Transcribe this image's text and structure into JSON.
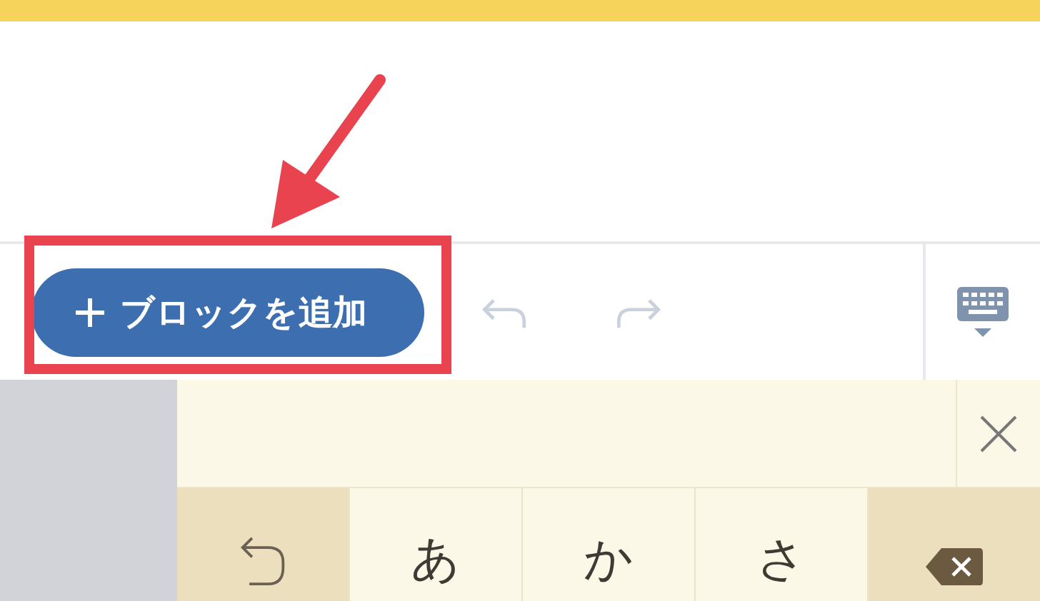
{
  "toolbar": {
    "add_block_button": {
      "label": "ブロックを追加"
    },
    "history": [
      {
        "kind": "undo",
        "disabled": true
      },
      {
        "kind": "redo",
        "disabled": true
      }
    ]
  },
  "keyboard": {
    "keys": [
      {
        "kind": "undo"
      },
      {
        "kind": "char",
        "label": "あ"
      },
      {
        "kind": "char",
        "label": "か"
      },
      {
        "kind": "char",
        "label": "さ"
      },
      {
        "kind": "delete"
      }
    ]
  }
}
